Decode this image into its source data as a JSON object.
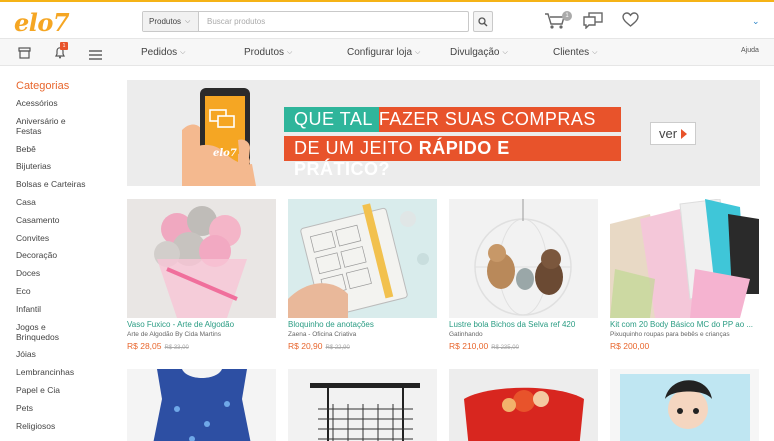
{
  "brand": {
    "logo_text": "elo7",
    "accent": "#f5a623",
    "green": "#2a9c83",
    "orange": "#e8662d"
  },
  "search": {
    "category": "Produtos",
    "placeholder": "Buscar produtos"
  },
  "header_icons": {
    "cart_count": "1",
    "cart": "cart-icon",
    "messages": "chat-icon",
    "favorites": "heart-icon"
  },
  "nav": {
    "notifications_count": "1",
    "items": [
      "Pedidos",
      "Produtos",
      "Configurar loja",
      "Divulgação",
      "Clientes"
    ],
    "help": "Ajuda"
  },
  "sidebar": {
    "title": "Categorias",
    "categories": [
      "Acessórios",
      "Aniversário e Festas",
      "Bebê",
      "Bijuterias",
      "Bolsas e Carteiras",
      "Casa",
      "Casamento",
      "Convites",
      "Decoração",
      "Doces",
      "Eco",
      "Infantil",
      "Jogos e Brinquedos",
      "Jóias",
      "Lembrancinhas",
      "Papel e Cia",
      "Pets",
      "Religiosos"
    ]
  },
  "banner": {
    "line1_a": "QUE TAL",
    "line1_b": "FAZER SUAS COMPRAS",
    "line2_a": "DE UM JEITO",
    "line2_b": "RÁPIDO E PRÁTICO?",
    "phone_logo": "elo7",
    "cta": "ver"
  },
  "products": [
    {
      "name": "Vaso Fuxico - Arte de Algodão",
      "shop": "Arte de Algodão By Cida Martins",
      "price": "R$ 28,05",
      "old_price": "R$ 33,00"
    },
    {
      "name": "Bloquinho de anotações",
      "shop": "Zaena - Oficina Criativa",
      "price": "R$ 20,90",
      "old_price": "R$ 22,90"
    },
    {
      "name": "Lustre bola Bichos da Selva ref 420",
      "shop": "Gatinhando",
      "price": "R$ 210,00",
      "old_price": "R$ 235,00"
    },
    {
      "name": "Kit com 20 Body Básico MC do PP ao ...",
      "shop": "Pixuquinho roupas para bebês e crianças",
      "price": "R$ 200,00",
      "old_price": ""
    }
  ]
}
